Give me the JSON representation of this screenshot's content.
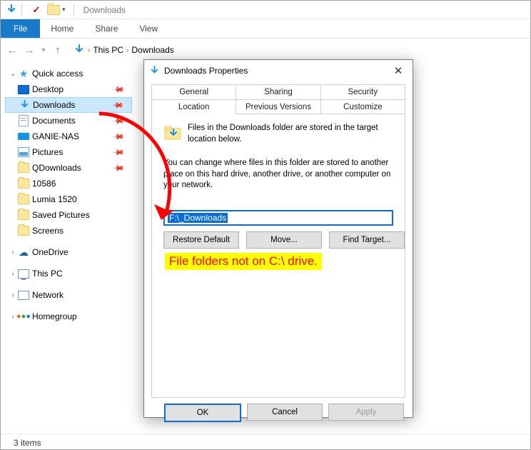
{
  "qat": {
    "title": "Downloads"
  },
  "ribbon": {
    "file": "File",
    "tabs": [
      "Home",
      "Share",
      "View"
    ]
  },
  "breadcrumb": {
    "items": [
      "This PC",
      "Downloads"
    ]
  },
  "tree": {
    "quick_access": "Quick access",
    "items": [
      {
        "label": "Desktop",
        "pin": true
      },
      {
        "label": "Downloads",
        "pin": true,
        "selected": true
      },
      {
        "label": "Documents",
        "pin": true
      },
      {
        "label": "GANIE-NAS",
        "pin": true
      },
      {
        "label": "Pictures",
        "pin": true
      },
      {
        "label": "QDownloads",
        "pin": true
      },
      {
        "label": "10586"
      },
      {
        "label": "Lumia 1520"
      },
      {
        "label": "Saved Pictures"
      },
      {
        "label": "Screens"
      }
    ],
    "onedrive": "OneDrive",
    "this_pc": "This PC",
    "network": "Network",
    "homegroup": "Homegroup"
  },
  "status": {
    "text": "3 items"
  },
  "dialog": {
    "title": "Downloads Properties",
    "tabs_top": [
      "General",
      "Sharing",
      "Security"
    ],
    "tabs_bottom": [
      "Location",
      "Previous Versions",
      "Customize"
    ],
    "active_tab": "Location",
    "desc1": "Files in the Downloads folder are stored in the target location below.",
    "desc2": "You can change where files in this folder are stored to another place on this hard drive, another drive, or another computer on your network.",
    "path_value": "F:\\_Downloads",
    "buttons": {
      "restore": "Restore Default",
      "move": "Move...",
      "find": "Find Target..."
    },
    "footer": {
      "ok": "OK",
      "cancel": "Cancel",
      "apply": "Apply"
    }
  },
  "annotation": {
    "text": "File folders not on C:\\ drive."
  }
}
